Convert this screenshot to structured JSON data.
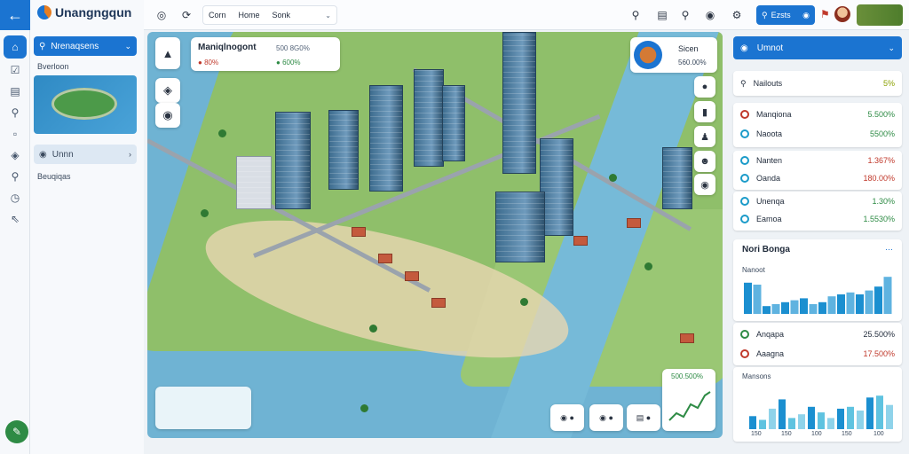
{
  "app": {
    "name": "Unangngqun"
  },
  "left_panel": {
    "search_label": "Nrenaqsens",
    "section_label": "Bverloon",
    "select_label": "Unnn",
    "footer_label": "Beuqiqas"
  },
  "topbar": {
    "tabs": [
      "Corn",
      "Home",
      "Sonk"
    ],
    "search_label": "Ezsts"
  },
  "map": {
    "title_card": {
      "title": "Maniqlnogont",
      "value": "500 8G0%",
      "badge_left": "80%",
      "badge_right": "600%"
    },
    "store_card": {
      "name": "Sicen",
      "value": "560.00%"
    },
    "graph_value": "500.500%"
  },
  "right_panel": {
    "header": "Umnot",
    "summary": {
      "label": "Nailouts",
      "value": "5%"
    },
    "list1": [
      {
        "label": "Manqiona",
        "value": "5.500%",
        "color": "#c0392b",
        "val_color": "#2e8b45"
      },
      {
        "label": "Naoota",
        "value": "5500%",
        "color": "#1b9bc9",
        "val_color": "#2e8b45"
      },
      {
        "label": "Nanten",
        "value": "1.367%",
        "color": "#1b9bc9",
        "val_color": "#c0392b"
      },
      {
        "label": "Oanda",
        "value": "180.00%",
        "color": "#1b9bc9",
        "val_color": "#c0392b"
      },
      {
        "label": "Unenqa",
        "value": "1.30%",
        "color": "#1b9bc9",
        "val_color": "#2e8b45"
      },
      {
        "label": "Eamoa",
        "value": "1.5530%",
        "color": "#1b9bc9",
        "val_color": "#2e8b45"
      }
    ],
    "chart_card": {
      "title": "Nori Bonga",
      "subtitle": "Nanoot"
    },
    "list2": [
      {
        "label": "Anqapa",
        "value": "25.500%",
        "color": "#2e8b45",
        "val_color": "#1f2a3a"
      },
      {
        "label": "Aaagna",
        "value": "17.500%",
        "color": "#c0392b",
        "val_color": "#c0392b"
      }
    ],
    "bottom_card": {
      "subtitle": "Mansons",
      "xlabels": [
        "150",
        "150",
        "100",
        "150",
        "100"
      ]
    }
  },
  "chart_data": [
    {
      "type": "bar",
      "title": "Nori Bonga",
      "subtitle": "Nanoot",
      "values": [
        0.8,
        0.75,
        0.2,
        0.25,
        0.3,
        0.35,
        0.4,
        0.25,
        0.3,
        0.45,
        0.5,
        0.55,
        0.5,
        0.6,
        0.7,
        0.95
      ]
    },
    {
      "type": "bar",
      "title": "Mansons",
      "categories": [
        "150",
        "150",
        "100",
        "150",
        "100"
      ],
      "values": [
        0.35,
        0.25,
        0.55,
        0.8,
        0.3,
        0.4,
        0.6,
        0.45,
        0.3,
        0.55,
        0.6,
        0.5,
        0.85,
        0.9,
        0.65
      ]
    }
  ]
}
